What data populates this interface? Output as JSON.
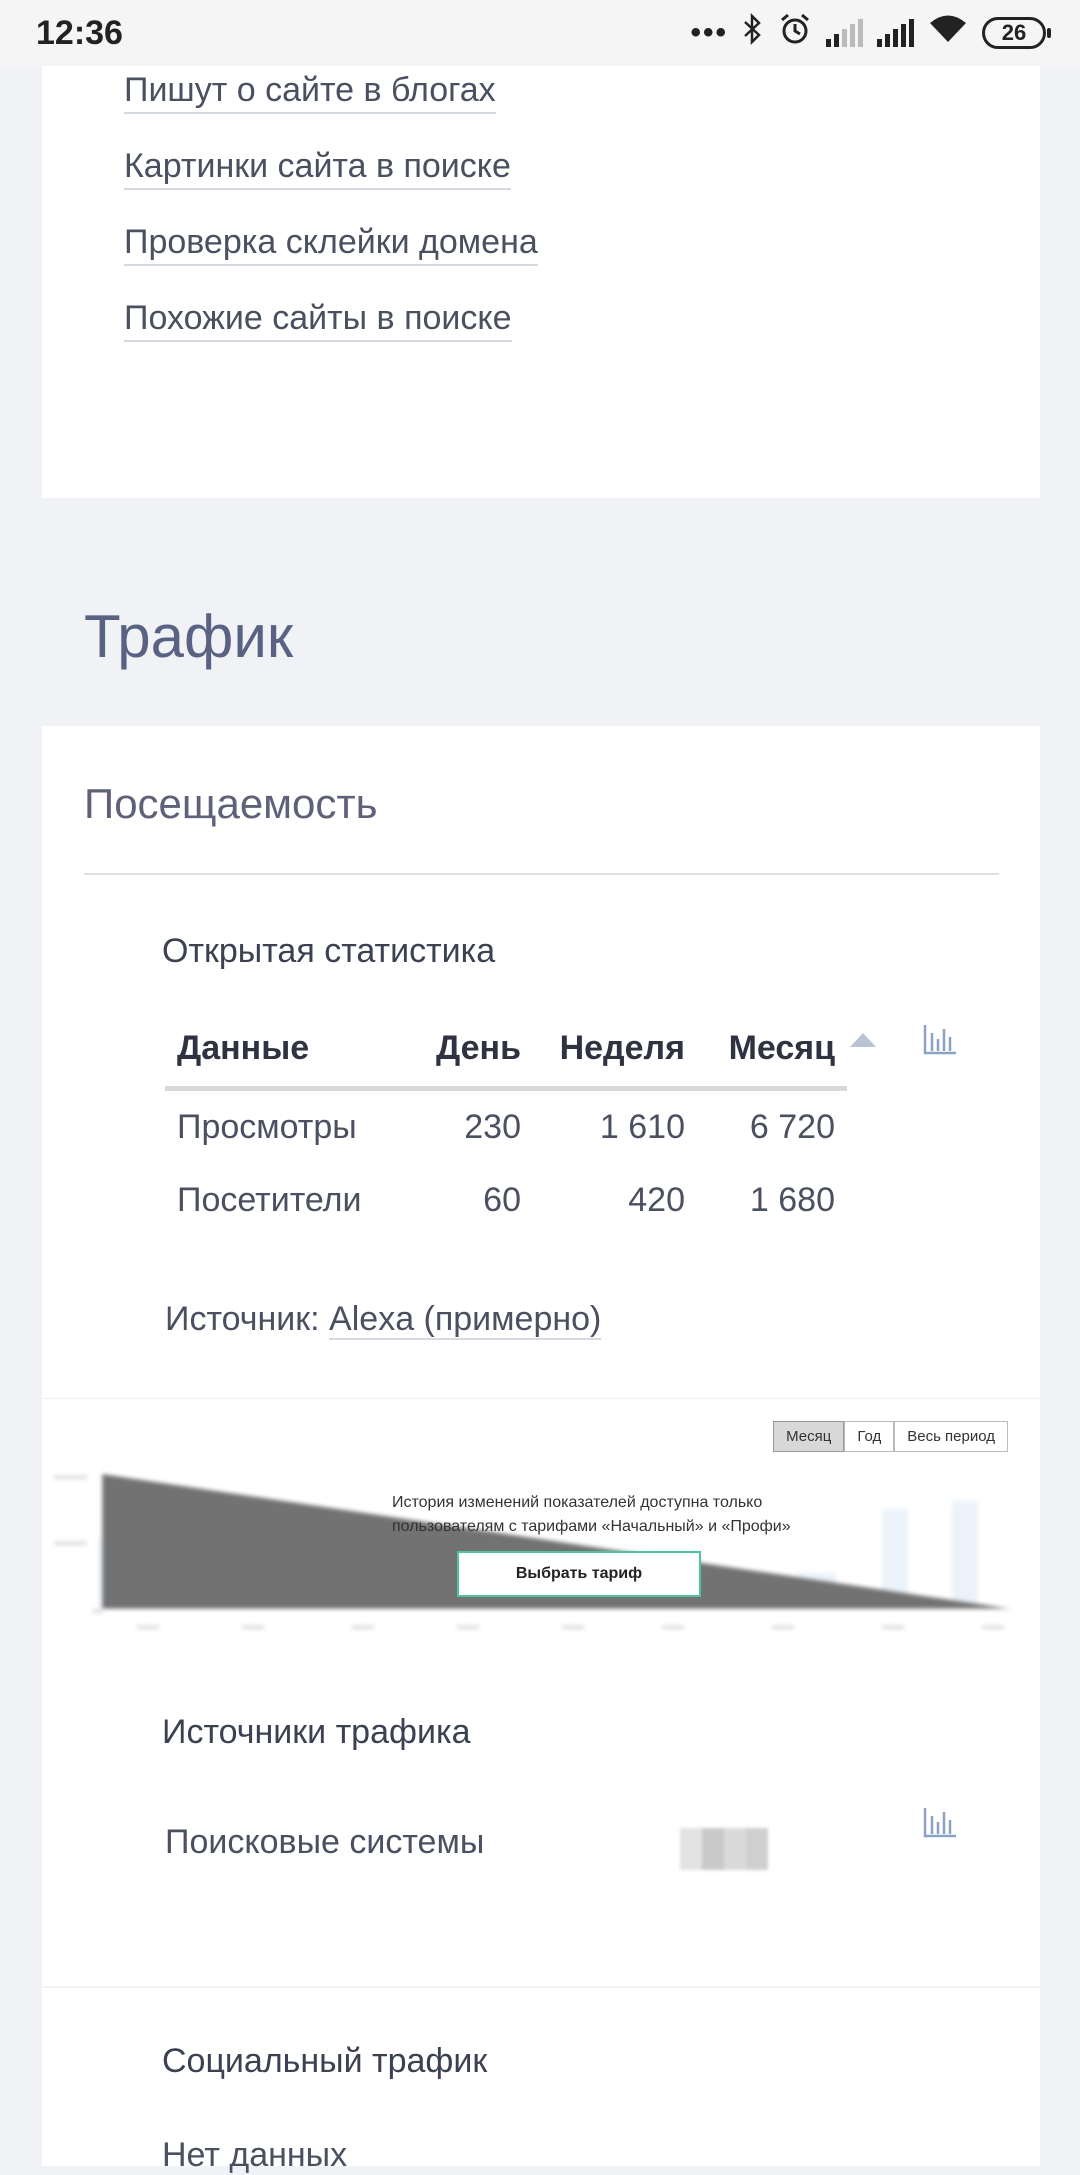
{
  "status_bar": {
    "time": "12:36",
    "battery": "26"
  },
  "links": [
    "Пишут о сайте в блогах",
    "Картинки сайта в поиске",
    "Проверка склейки домена",
    "Похожие сайты в поиске"
  ],
  "traffic": {
    "title": "Трафик",
    "attendance_title": "Посещаемость",
    "open_stats_title": "Открытая статистика",
    "table": {
      "headers": [
        "Данные",
        "День",
        "Неделя",
        "Месяц"
      ],
      "rows": [
        [
          "Просмотры",
          "230",
          "1 610",
          "6 720"
        ],
        [
          "Посетители",
          "60",
          "420",
          "1 680"
        ]
      ]
    },
    "source_prefix": "Источник:",
    "source_link": "Alexa (примерно)",
    "chart": {
      "buttons": [
        "Месяц",
        "Год",
        "Весь период"
      ],
      "notice_line1": "История изменений показателей доступна только",
      "notice_line2": "пользователям с тарифами «Начальный» и «Профи»",
      "tariff_button": "Выбрать тариф"
    },
    "sources_title": "Источники трафика",
    "search_engines_label": "Поисковые системы",
    "social_title": "Социальный трафик",
    "social_value": "Нет данных"
  },
  "colors": {
    "accent_green": "#4fc4a0",
    "title_blue": "#5a6283"
  }
}
